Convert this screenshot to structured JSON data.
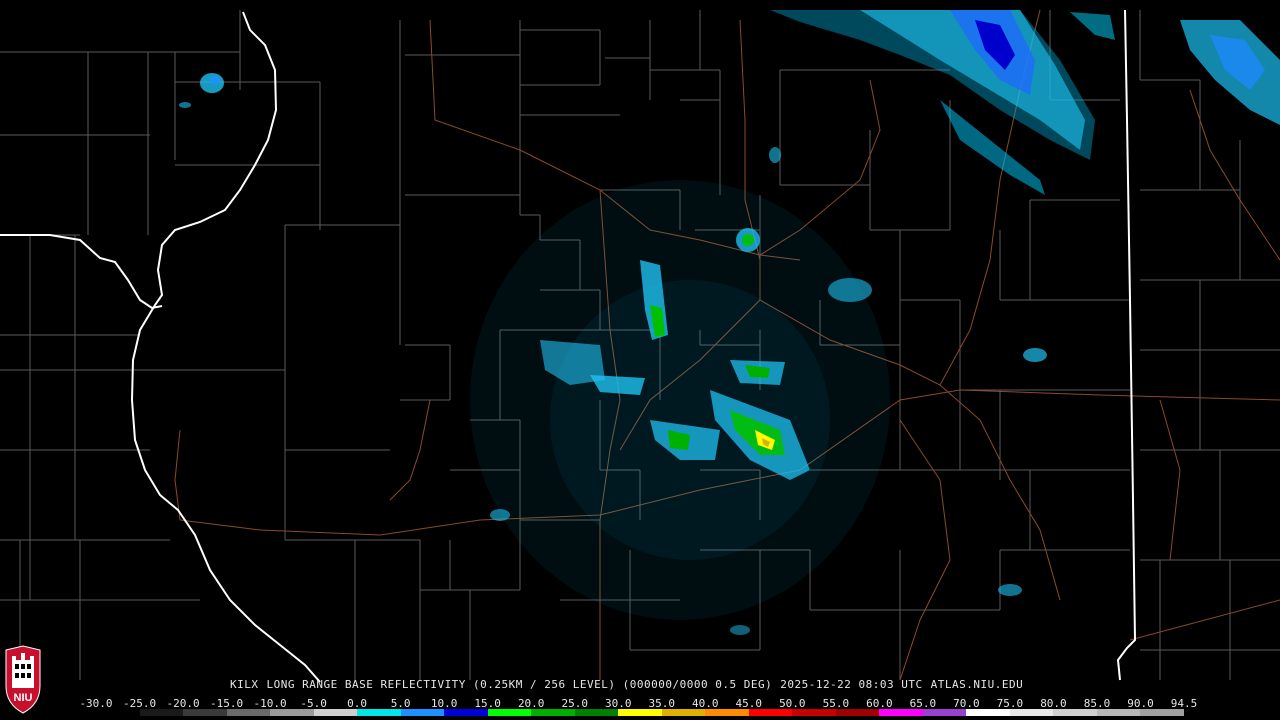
{
  "caption": {
    "radar": "KILX",
    "product": "LONG RANGE BASE REFLECTIVITY (0.25KM / 256 LEVEL) (000000/0000 0.5 DEG)",
    "timestamp": "2025-12-22 08:03 UTC",
    "site": "ATLAS.NIU.EDU"
  },
  "logo": {
    "text": "NIU"
  },
  "scale": {
    "ticks": [
      "-30.0",
      "-25.0",
      "-20.0",
      "-15.0",
      "-10.0",
      "-5.0",
      "0.0",
      "5.0",
      "10.0",
      "15.0",
      "20.0",
      "25.0",
      "30.0",
      "35.0",
      "40.0",
      "45.0",
      "50.0",
      "55.0",
      "60.0",
      "65.0",
      "70.0",
      "75.0",
      "80.0",
      "85.0",
      "90.0",
      "94.5"
    ],
    "colors": [
      "#000000",
      "#1a1a1a",
      "#3a3a3a",
      "#6a6a6a",
      "#9a9a9a",
      "#cfcfcf",
      "#00e5e5",
      "#1e90ff",
      "#0000d8",
      "#00ff00",
      "#00b000",
      "#008000",
      "#ffff00",
      "#e0b000",
      "#ff8c00",
      "#ff0000",
      "#c80000",
      "#a00000",
      "#ff00ff",
      "#9a40d0",
      "#ffffff",
      "#e8e8e8",
      "#d0d0d0",
      "#b8b8b8",
      "#a0a0a0"
    ]
  },
  "colors": {
    "state_border": "#ffffff",
    "county_line": "#5a5a5a",
    "highway": "#8b4a2a",
    "background": "#000000"
  }
}
